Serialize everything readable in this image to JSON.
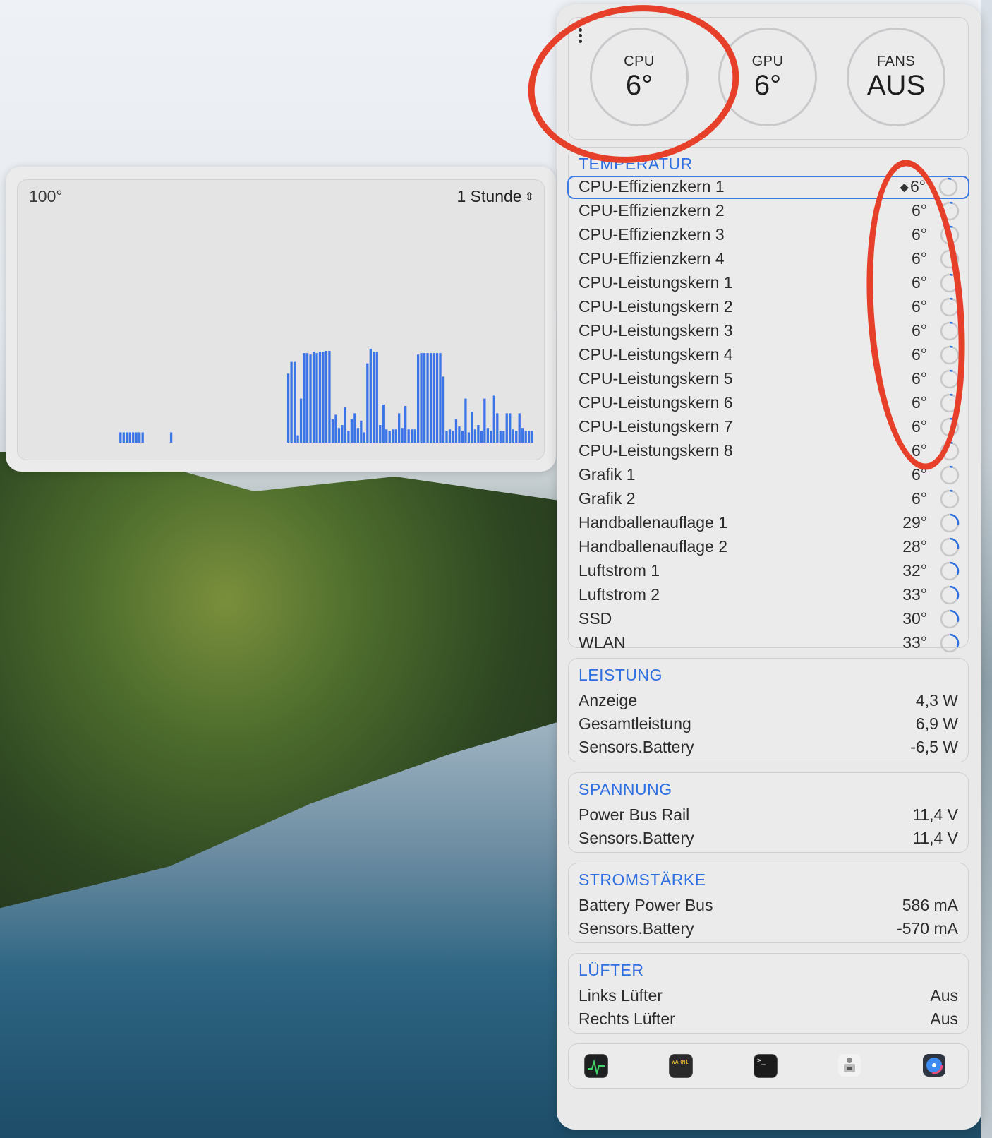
{
  "chart": {
    "max_label": "100°",
    "period": "1 Stunde",
    "bars": [
      0,
      0,
      0,
      0,
      0,
      0,
      0,
      0,
      0,
      0,
      0,
      0,
      0,
      0,
      0,
      0,
      0,
      0,
      0,
      0,
      0,
      0,
      0,
      0,
      0,
      0,
      0,
      0,
      0,
      14,
      14,
      14,
      14,
      14,
      14,
      14,
      14,
      0,
      0,
      0,
      0,
      0,
      0,
      0,
      0,
      14,
      0,
      0,
      0,
      0,
      0,
      0,
      0,
      0,
      0,
      0,
      0,
      0,
      0,
      0,
      0,
      0,
      0,
      0,
      0,
      0,
      0,
      0,
      0,
      0,
      0,
      0,
      0,
      0,
      0,
      0,
      0,
      0,
      0,
      0,
      0,
      0,
      94,
      110,
      110,
      10,
      60,
      122,
      122,
      120,
      124,
      122,
      124,
      124,
      125,
      125,
      32,
      38,
      20,
      24,
      48,
      16,
      32,
      40,
      20,
      30,
      14,
      108,
      128,
      124,
      124,
      24,
      52,
      18,
      16,
      18,
      18,
      40,
      20,
      50,
      18,
      18,
      18,
      120,
      122,
      122,
      122,
      122,
      122,
      122,
      122,
      90,
      16,
      18,
      16,
      32,
      22,
      16,
      60,
      14,
      42,
      18,
      24,
      16,
      60,
      20,
      16,
      64,
      40,
      16,
      16,
      40,
      40,
      18,
      16,
      40,
      20,
      16,
      16,
      16
    ]
  },
  "gauges": [
    {
      "label": "CPU",
      "value": "6°"
    },
    {
      "label": "GPU",
      "value": "6°"
    },
    {
      "label": "FANS",
      "value": "AUS"
    }
  ],
  "temperature": {
    "title": "TEMPERATUR",
    "rows": [
      {
        "label": "CPU-Effizienzkern 1",
        "value": "6°",
        "level": 0.06
      },
      {
        "label": "CPU-Effizienzkern 2",
        "value": "6°",
        "level": 0.06
      },
      {
        "label": "CPU-Effizienzkern 3",
        "value": "6°",
        "level": 0.06
      },
      {
        "label": "CPU-Effizienzkern 4",
        "value": "6°",
        "level": 0.06
      },
      {
        "label": "CPU-Leistungskern 1",
        "value": "6°",
        "level": 0.06
      },
      {
        "label": "CPU-Leistungskern 2",
        "value": "6°",
        "level": 0.06
      },
      {
        "label": "CPU-Leistungskern 3",
        "value": "6°",
        "level": 0.06
      },
      {
        "label": "CPU-Leistungskern 4",
        "value": "6°",
        "level": 0.06
      },
      {
        "label": "CPU-Leistungskern 5",
        "value": "6°",
        "level": 0.06
      },
      {
        "label": "CPU-Leistungskern 6",
        "value": "6°",
        "level": 0.06
      },
      {
        "label": "CPU-Leistungskern 7",
        "value": "6°",
        "level": 0.06
      },
      {
        "label": "CPU-Leistungskern 8",
        "value": "6°",
        "level": 0.06
      },
      {
        "label": "Grafik 1",
        "value": "6°",
        "level": 0.06
      },
      {
        "label": "Grafik 2",
        "value": "6°",
        "level": 0.06
      },
      {
        "label": "Handballenauflage 1",
        "value": "29°",
        "level": 0.29
      },
      {
        "label": "Handballenauflage 2",
        "value": "28°",
        "level": 0.28
      },
      {
        "label": "Luftstrom 1",
        "value": "32°",
        "level": 0.32
      },
      {
        "label": "Luftstrom 2",
        "value": "33°",
        "level": 0.33
      },
      {
        "label": "SSD",
        "value": "30°",
        "level": 0.3
      },
      {
        "label": "WLAN",
        "value": "33°",
        "level": 0.33
      }
    ]
  },
  "power": {
    "title": "LEISTUNG",
    "rows": [
      {
        "label": "Anzeige",
        "value": "4,3 W"
      },
      {
        "label": "Gesamtleistung",
        "value": "6,9 W"
      },
      {
        "label": "Sensors.Battery",
        "value": "-6,5 W"
      }
    ]
  },
  "voltage": {
    "title": "SPANNUNG",
    "rows": [
      {
        "label": "Power Bus Rail",
        "value": "11,4 V"
      },
      {
        "label": "Sensors.Battery",
        "value": "11,4 V"
      }
    ]
  },
  "current": {
    "title": "STROMSTÄRKE",
    "rows": [
      {
        "label": "Battery Power Bus",
        "value": "586 mA"
      },
      {
        "label": "Sensors.Battery",
        "value": "-570 mA"
      }
    ]
  },
  "fans": {
    "title": "LÜFTER",
    "rows": [
      {
        "label": "Links Lüfter",
        "value": "Aus"
      },
      {
        "label": "Rechts Lüfter",
        "value": "Aus"
      }
    ]
  },
  "dock": [
    {
      "name": "activity-monitor-icon"
    },
    {
      "name": "console-icon",
      "label": "WARNI"
    },
    {
      "name": "terminal-icon",
      "label": ">_"
    },
    {
      "name": "system-information-icon"
    },
    {
      "name": "disk-utility-icon"
    }
  ],
  "colors": {
    "accent": "#2f6fe0",
    "bar": "#3b74e6",
    "annotation": "#e6402b"
  }
}
